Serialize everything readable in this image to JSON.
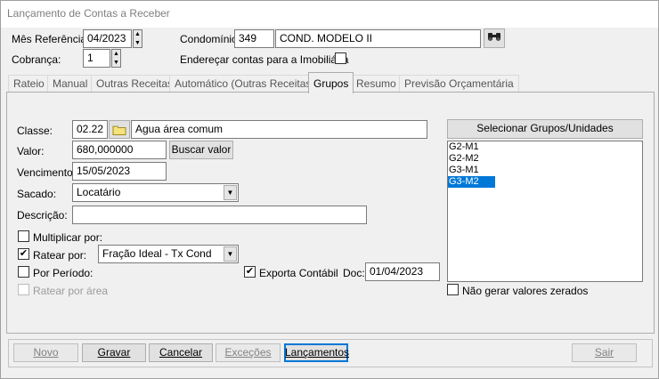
{
  "window": {
    "title": "Lançamento de Contas a Receber"
  },
  "header": {
    "mes_referencia_label": "Mês Referência:",
    "mes_referencia_value": "04/2023",
    "cobranca_label": "Cobrança:",
    "cobranca_value": "1",
    "condominio_label": "Condomínio:",
    "condominio_code": "349",
    "condominio_name": "COND. MODELO II",
    "enderecar_label": "Endereçar contas para a Imobiliária"
  },
  "tabs": [
    {
      "label": "Rateio"
    },
    {
      "label": "Manual"
    },
    {
      "label": "Outras Receitas"
    },
    {
      "label": "Automático (Outras Receitas)"
    },
    {
      "label": "Grupos"
    },
    {
      "label": "Resumo"
    },
    {
      "label": "Previsão Orçamentária"
    }
  ],
  "active_tab": "Grupos",
  "form": {
    "classe_label": "Classe:",
    "classe_code": "02.22",
    "classe_desc": "Agua área comum",
    "valor_label": "Valor:",
    "valor_value": "680,000000",
    "buscar_valor_label": "Buscar valor",
    "vencimento_label": "Vencimento:",
    "vencimento_value": "15/05/2023",
    "sacado_label": "Sacado:",
    "sacado_value": "Locatário",
    "descricao_label": "Descrição:",
    "descricao_value": "",
    "multiplicar_label": "Multiplicar por:",
    "ratear_label": "Ratear por:",
    "ratear_value": "Fração Ideal - Tx Cond",
    "por_periodo_label": "Por Período:",
    "exporta_contabil_label": "Exporta Contábil",
    "doc_label": "Doc:",
    "doc_value": "01/04/2023",
    "ratear_area_label": "Ratear por área"
  },
  "groups": {
    "select_button_label": "Selecionar Grupos/Unidades",
    "items": [
      "G2-M1",
      "G2-M2",
      "G3-M1",
      "G3-M2"
    ],
    "selected_item": "G3-M2",
    "nao_gerar_label": "Não gerar valores zerados"
  },
  "footer": {
    "novo": "Novo",
    "gravar": "Gravar",
    "cancelar": "Cancelar",
    "excecoes": "Exceções",
    "lancamentos": "Lançamentos",
    "sair": "Sair"
  },
  "colors": {
    "selection": "#0078d7",
    "title_text": "#7f7f7f"
  }
}
